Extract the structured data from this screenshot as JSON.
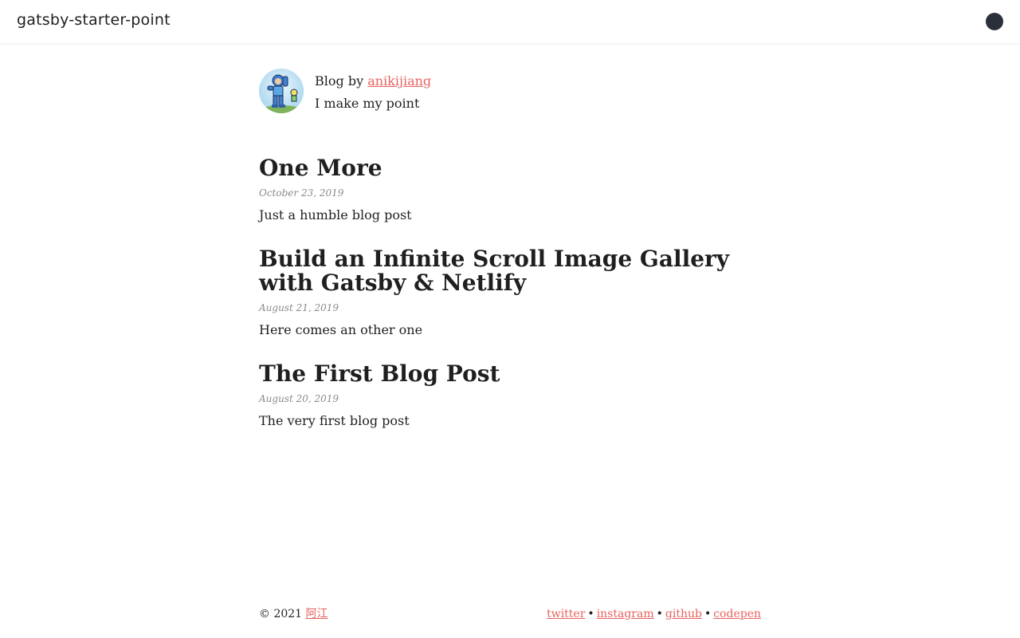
{
  "header": {
    "site_title": "gatsby-starter-point",
    "toggle_icon": "dark-mode-toggle-icon"
  },
  "bio": {
    "avatar_icon": "avatar-megaman-icon",
    "prefix": "Blog by",
    "author": "anikijiang",
    "tagline": "I make my point"
  },
  "posts": [
    {
      "title": "One More",
      "date": "October 23, 2019",
      "excerpt": "Just a humble blog post"
    },
    {
      "title": "Build an Infinite Scroll Image Gallery with Gatsby & Netlify",
      "date": "August 21, 2019",
      "excerpt": "Here comes an other one"
    },
    {
      "title": "The First Blog Post",
      "date": "August 20, 2019",
      "excerpt": "The very first blog post"
    }
  ],
  "footer": {
    "copyright": "© 2021",
    "author_link": "阿江",
    "social": [
      "twitter",
      "instagram",
      "github",
      "codepen"
    ],
    "separator": "•"
  },
  "colors": {
    "link": "#e7625f",
    "text": "#1f1f1f",
    "date": "#8a8a8a",
    "toggle": "#2a2f3a"
  }
}
